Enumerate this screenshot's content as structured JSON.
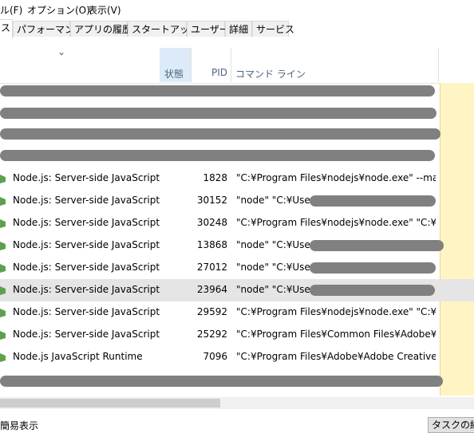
{
  "menu": [
    {
      "label": "ル(F)"
    },
    {
      "label": "オプション(O)"
    },
    {
      "label": "表示(V)"
    }
  ],
  "tabs": [
    {
      "label": "ス",
      "active": true
    },
    {
      "label": "パフォーマンス"
    },
    {
      "label": "アプリの履歴"
    },
    {
      "label": "スタートアップ"
    },
    {
      "label": "ユーザー"
    },
    {
      "label": "詳細"
    },
    {
      "label": "サービス"
    }
  ],
  "columns": {
    "status": "状態",
    "pid": "PID",
    "command_line": "コマンド ライン"
  },
  "processes": [
    {
      "name": "Node.js: Server-side JavaScript",
      "pid": "1828",
      "command": "\"C:¥Program Files¥nodejs¥node.exe\" --max-...",
      "redacted": false
    },
    {
      "name": "Node.js: Server-side JavaScript",
      "pid": "30152",
      "command": "\"node\"  \"C:¥Users",
      "redacted": true
    },
    {
      "name": "Node.js: Server-side JavaScript",
      "pid": "30248",
      "command": "\"C:¥Program Files¥nodejs¥node.exe\"  \"C:¥Us...",
      "redacted": false
    },
    {
      "name": "Node.js: Server-side JavaScript",
      "pid": "13868",
      "command": "\"node\"  \"C:¥Users",
      "redacted": true
    },
    {
      "name": "Node.js: Server-side JavaScript",
      "pid": "27012",
      "command": "\"node\"  \"C:¥Users",
      "redacted": true
    },
    {
      "name": "Node.js: Server-side JavaScript",
      "pid": "23964",
      "command": "\"node\"  \"C:¥Users",
      "redacted": true,
      "selected": true
    },
    {
      "name": "Node.js: Server-side JavaScript",
      "pid": "29592",
      "command": "\"C:¥Program Files¥nodejs¥node.exe\"  \"C:¥Us...",
      "redacted": false
    },
    {
      "name": "Node.js: Server-side JavaScript",
      "pid": "25292",
      "command": "\"C:¥Program Files¥Common Files¥Adobe¥Cre...",
      "redacted": false
    },
    {
      "name": "Node.js JavaScript Runtime",
      "pid": "7096",
      "command": "\"C:¥Program Files¥Adobe¥Adobe Creative Cl...",
      "redacted": false
    }
  ],
  "footer": {
    "left_text": "簡易表示",
    "button_label": "タスクの終了"
  },
  "colors": {
    "node_icon": "#5fa04e",
    "redaction": "#808080",
    "selected_row": "#e5e5e5",
    "status_header": "#dcebf7",
    "highlight_column": "#fff4c4"
  }
}
